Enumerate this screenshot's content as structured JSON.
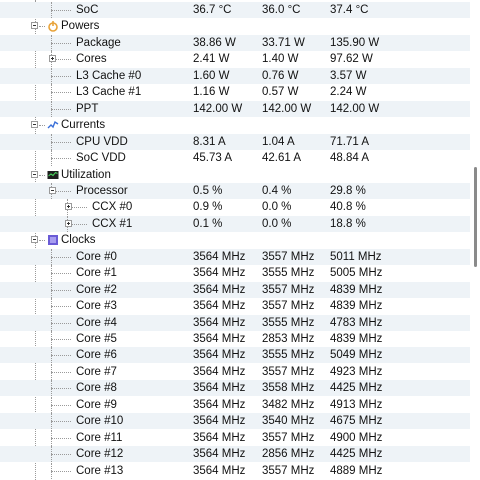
{
  "rows": [
    {
      "type": "item",
      "depth": 1,
      "label": "SoC",
      "values": [
        "36.7 °C",
        "36.0 °C",
        "37.4 °C"
      ]
    },
    {
      "type": "section",
      "label": "Powers",
      "icon": "power-icon",
      "expanded": true
    },
    {
      "type": "item",
      "depth": 1,
      "label": "Package",
      "values": [
        "38.86 W",
        "33.71 W",
        "135.90 W"
      ]
    },
    {
      "type": "item",
      "depth": 1,
      "label": "Cores",
      "values": [
        "2.41 W",
        "1.40 W",
        "97.62 W"
      ],
      "toggle": "plus"
    },
    {
      "type": "item",
      "depth": 1,
      "label": "L3 Cache #0",
      "values": [
        "1.60 W",
        "0.76 W",
        "3.57 W"
      ]
    },
    {
      "type": "item",
      "depth": 1,
      "label": "L3 Cache #1",
      "values": [
        "1.16 W",
        "0.57 W",
        "2.24 W"
      ]
    },
    {
      "type": "item",
      "depth": 1,
      "label": "PPT",
      "values": [
        "142.00 W",
        "142.00 W",
        "142.00 W"
      ]
    },
    {
      "type": "section",
      "label": "Currents",
      "icon": "current-icon",
      "expanded": true
    },
    {
      "type": "item",
      "depth": 1,
      "label": "CPU VDD",
      "values": [
        "8.31 A",
        "1.04 A",
        "71.71 A"
      ]
    },
    {
      "type": "item",
      "depth": 1,
      "label": "SoC VDD",
      "values": [
        "45.73 A",
        "42.61 A",
        "48.84 A"
      ]
    },
    {
      "type": "section",
      "label": "Utilization",
      "icon": "utilization-icon",
      "expanded": true
    },
    {
      "type": "item",
      "depth": 1,
      "label": "Processor",
      "values": [
        "0.5 %",
        "0.4 %",
        "29.8 %"
      ],
      "toggle": "minus"
    },
    {
      "type": "item",
      "depth": 2,
      "label": "CCX #0",
      "values": [
        "0.9 %",
        "0.0 %",
        "40.8 %"
      ],
      "toggle": "plus"
    },
    {
      "type": "item",
      "depth": 2,
      "label": "CCX #1",
      "values": [
        "0.1 %",
        "0.0 %",
        "18.8 %"
      ],
      "toggle": "plus"
    },
    {
      "type": "section",
      "label": "Clocks",
      "icon": "clock-icon",
      "expanded": true
    },
    {
      "type": "item",
      "depth": 1,
      "label": "Core #0",
      "values": [
        "3564 MHz",
        "3557 MHz",
        "5011 MHz"
      ]
    },
    {
      "type": "item",
      "depth": 1,
      "label": "Core #1",
      "values": [
        "3564 MHz",
        "3555 MHz",
        "5005 MHz"
      ]
    },
    {
      "type": "item",
      "depth": 1,
      "label": "Core #2",
      "values": [
        "3564 MHz",
        "3557 MHz",
        "4839 MHz"
      ]
    },
    {
      "type": "item",
      "depth": 1,
      "label": "Core #3",
      "values": [
        "3564 MHz",
        "3557 MHz",
        "4839 MHz"
      ]
    },
    {
      "type": "item",
      "depth": 1,
      "label": "Core #4",
      "values": [
        "3564 MHz",
        "3555 MHz",
        "4783 MHz"
      ]
    },
    {
      "type": "item",
      "depth": 1,
      "label": "Core #5",
      "values": [
        "3564 MHz",
        "2853 MHz",
        "4839 MHz"
      ]
    },
    {
      "type": "item",
      "depth": 1,
      "label": "Core #6",
      "values": [
        "3564 MHz",
        "3555 MHz",
        "5049 MHz"
      ]
    },
    {
      "type": "item",
      "depth": 1,
      "label": "Core #7",
      "values": [
        "3564 MHz",
        "3557 MHz",
        "4923 MHz"
      ]
    },
    {
      "type": "item",
      "depth": 1,
      "label": "Core #8",
      "values": [
        "3564 MHz",
        "3558 MHz",
        "4425 MHz"
      ]
    },
    {
      "type": "item",
      "depth": 1,
      "label": "Core #9",
      "values": [
        "3564 MHz",
        "3482 MHz",
        "4913 MHz"
      ]
    },
    {
      "type": "item",
      "depth": 1,
      "label": "Core #10",
      "values": [
        "3564 MHz",
        "3540 MHz",
        "4675 MHz"
      ]
    },
    {
      "type": "item",
      "depth": 1,
      "label": "Core #11",
      "values": [
        "3564 MHz",
        "3557 MHz",
        "4900 MHz"
      ]
    },
    {
      "type": "item",
      "depth": 1,
      "label": "Core #12",
      "values": [
        "3564 MHz",
        "2856 MHz",
        "4425 MHz"
      ]
    },
    {
      "type": "item",
      "depth": 1,
      "label": "Core #13",
      "values": [
        "3564 MHz",
        "3557 MHz",
        "4889 MHz"
      ]
    }
  ],
  "colors": {
    "row_alt": "#eef3f7",
    "power_icon": "#e8a33a",
    "current_icon": "#3a6fd8",
    "utilization_icon": "#2d8a3a",
    "clock_icon": "#6a5bd6"
  }
}
